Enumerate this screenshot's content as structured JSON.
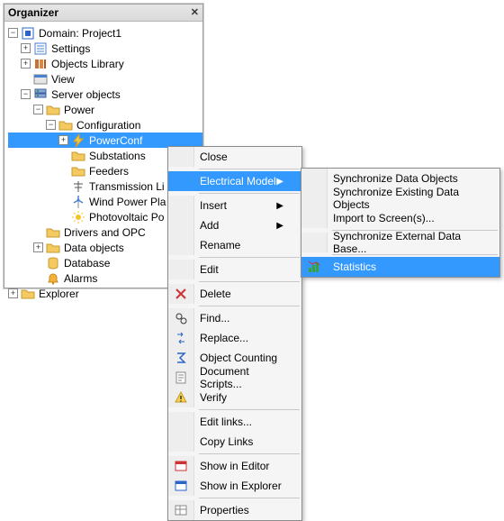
{
  "panel": {
    "title": "Organizer"
  },
  "tree": {
    "domain": "Domain: Project1",
    "settings": "Settings",
    "objects_library": "Objects Library",
    "view": "View",
    "server_objects": "Server objects",
    "power": "Power",
    "configuration": "Configuration",
    "power_conf": "PowerConf",
    "substations": "Substations",
    "feeders": "Feeders",
    "transmission": "Transmission Li",
    "wind": "Wind Power Pla",
    "photovoltaic": "Photovoltaic Po",
    "drivers_opc": "Drivers and OPC",
    "data_objects": "Data objects",
    "database": "Database",
    "alarms": "Alarms",
    "explorer": "Explorer"
  },
  "menu": {
    "close": "Close",
    "electrical_model": "Electrical Model",
    "insert": "Insert",
    "add": "Add",
    "rename": "Rename",
    "edit": "Edit",
    "delete": "Delete",
    "find": "Find...",
    "replace": "Replace...",
    "object_counting": "Object Counting",
    "document_scripts": "Document Scripts...",
    "verify": "Verify",
    "edit_links": "Edit links...",
    "copy_links": "Copy Links",
    "show_in_editor": "Show in Editor",
    "show_in_explorer": "Show in Explorer",
    "properties": "Properties"
  },
  "submenu": {
    "sync_data_objects": "Synchronize Data Objects",
    "sync_existing": "Synchronize Existing Data Objects",
    "import_screens": "Import to Screen(s)...",
    "sync_external": "Synchronize External Data Base...",
    "statistics": "Statistics"
  }
}
